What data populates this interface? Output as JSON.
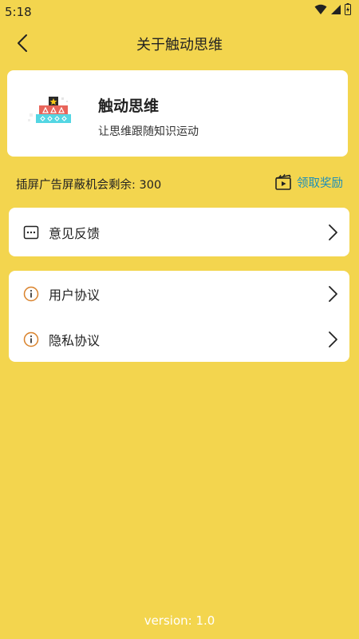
{
  "status_bar": {
    "time": "5:18"
  },
  "header": {
    "title": "关于触动思维"
  },
  "app": {
    "name": "触动思维",
    "slogan": "让思维跟随知识运动"
  },
  "ad": {
    "label": "插屏广告屏蔽机会剩余: 300",
    "reward_label": "领取奖励"
  },
  "menu_group_1": [
    {
      "label": "意见反馈",
      "icon": "message-dots-icon"
    }
  ],
  "menu_group_2": [
    {
      "label": "用户协议",
      "icon": "info-icon"
    },
    {
      "label": "隐私协议",
      "icon": "info-icon"
    }
  ],
  "footer": {
    "version": "version: 1.0"
  },
  "colors": {
    "background": "#F3D54E",
    "accent": "#1E8FB8",
    "card": "#FFFFFF"
  }
}
